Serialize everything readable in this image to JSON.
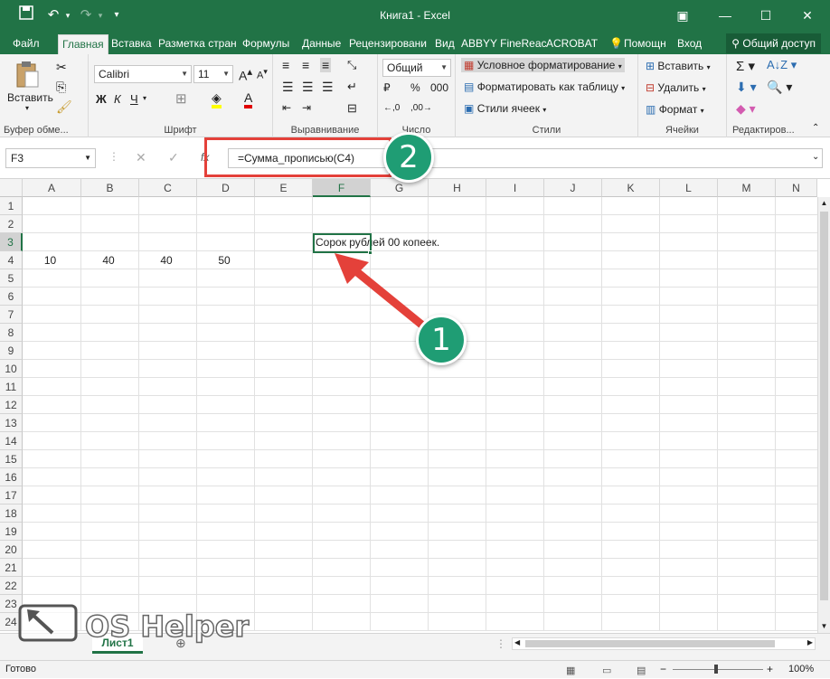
{
  "title": "Книга1 - Excel",
  "tabs": [
    "Файл",
    "Главная",
    "Вставка",
    "Разметка стран",
    "Формулы",
    "Данные",
    "Рецензировани",
    "Вид",
    "ABBYY FineReac",
    "ACROBAT"
  ],
  "help": "Помощн",
  "login": "Вход",
  "share": "Общий доступ",
  "ribbon": {
    "paste": "Вставить",
    "clipboard": "Буфер обме...",
    "font_name": "Calibri",
    "font_size": "11",
    "bold": "Ж",
    "italic": "К",
    "underline": "Ч",
    "font_group": "Шрифт",
    "align_group": "Выравнивание",
    "number_format": "Общий",
    "number_group": "Число",
    "cond_format": "Условное форматирование",
    "format_table": "Форматировать как таблицу",
    "cell_styles": "Стили ячеек",
    "styles_group": "Стили",
    "insert": "Вставить",
    "delete": "Удалить",
    "format": "Формат",
    "cells_group": "Ячейки",
    "edit_group": "Редактиров..."
  },
  "name_box": "F3",
  "fx": "fx",
  "formula": "=Сумма_прописью(C4)",
  "columns": [
    "A",
    "B",
    "C",
    "D",
    "E",
    "F",
    "G",
    "H",
    "I",
    "J",
    "K",
    "L",
    "M",
    "N"
  ],
  "rows": [
    "1",
    "2",
    "3",
    "4",
    "5",
    "6",
    "7",
    "8",
    "9",
    "10",
    "11",
    "12",
    "13",
    "14",
    "15",
    "16",
    "17",
    "18",
    "19",
    "20",
    "21",
    "22",
    "23",
    "24"
  ],
  "cells": {
    "a4": "10",
    "b4": "40",
    "c4": "40",
    "d4": "50",
    "f3": "Сорок рублей  00 копеек."
  },
  "badges": {
    "one": "1",
    "two": "2"
  },
  "sheet_tab": "Лист1",
  "status": "Готово",
  "zoom": "100%",
  "watermark": "OS Helper"
}
